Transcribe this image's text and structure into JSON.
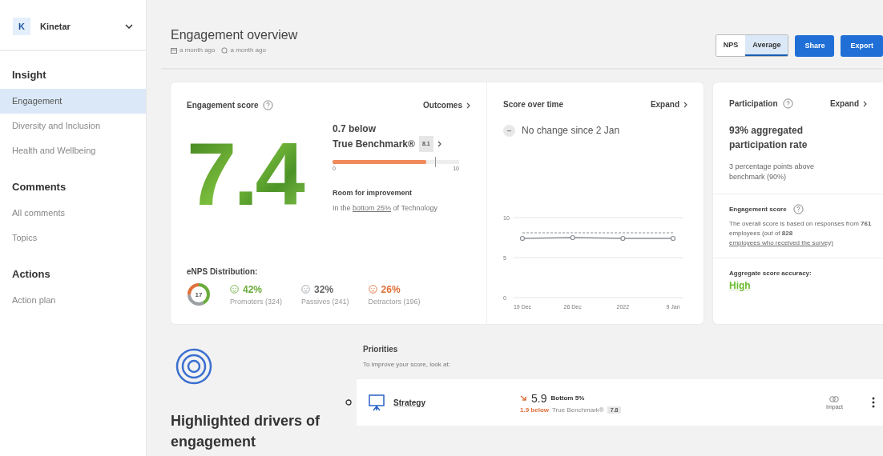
{
  "org": {
    "initial": "K",
    "name": "Kinetar"
  },
  "sidebar": {
    "sections": [
      {
        "title": "Insight",
        "items": [
          {
            "label": "Engagement",
            "selected": true
          },
          {
            "label": "Diversity and Inclusion",
            "selected": false
          },
          {
            "label": "Health and Wellbeing",
            "selected": false
          }
        ]
      },
      {
        "title": "Comments",
        "items": [
          {
            "label": "All comments",
            "selected": false
          },
          {
            "label": "Topics",
            "selected": false
          }
        ]
      },
      {
        "title": "Actions",
        "items": [
          {
            "label": "Action plan",
            "selected": false
          }
        ]
      }
    ]
  },
  "header": {
    "title": "Engagement overview",
    "created": "a month ago",
    "updated": "a month ago",
    "toggle": [
      {
        "label": "NPS",
        "selected": false
      },
      {
        "label": "Average",
        "selected": true
      }
    ],
    "buttons": [
      "Share",
      "Export"
    ]
  },
  "engagement": {
    "title": "Engagement score",
    "link": "Outcomes",
    "score": "7.4",
    "comparison": "0.7 below",
    "benchmark_label": "True Benchmark®",
    "benchmark_value": "8.1",
    "level": 0.74,
    "scale_min": "0",
    "scale_max": "10",
    "verdict": "Room for improvement",
    "rank": "In the **bottom 25%** of Technology",
    "enps": {
      "title": "eNPS Distribution:",
      "score": "17",
      "groups": [
        {
          "kind": "promoters",
          "percent": "42%",
          "label": "Promoters (324)",
          "color": "#6aab3a"
        },
        {
          "kind": "passives",
          "percent": "32%",
          "label": "Passives (241)",
          "color": "#9aa0a6"
        },
        {
          "kind": "detractors",
          "percent": "26%",
          "label": "Detractors (196)",
          "color": "#e0703a"
        }
      ]
    }
  },
  "score_over_time": {
    "title": "Score over time",
    "link": "Expand",
    "change": "No change since 2 Jan",
    "chart_data": {
      "type": "line",
      "categories": [
        "19 Dec",
        "26 Dec",
        "2022",
        "9 Jan"
      ],
      "ylim": [
        0,
        10
      ],
      "yticks": [
        0,
        5,
        10
      ],
      "series": [
        {
          "color": "#8a9096",
          "marker": "circle",
          "values": [
            7.4,
            7.5,
            7.4,
            7.4
          ]
        },
        {
          "color": "#8a9096",
          "line_style": "dashed",
          "values": [
            8.1,
            8.1,
            8.1,
            8.1
          ]
        }
      ]
    }
  },
  "participation": {
    "title": "Participation",
    "link": "Expand",
    "rate": "93% aggregated participation rate",
    "note": "3 percentage points above benchmark (90%)",
    "score_title": "Engagement score",
    "score_text": "The overall score is based on responses from **761** employees (out of **828** ",
    "score_link": "employees who received the survey)",
    "accuracy_title": "Aggregate score accuracy:",
    "accuracy": "High"
  },
  "drivers": {
    "title": "Highlighted drivers of engagement"
  },
  "priorities": {
    "title": "Priorities",
    "subtitle": "To improve your score, look at:",
    "items": [
      {
        "name": "Strategy",
        "score": "5.9",
        "rank": "Bottom 5%",
        "difference": "1.9 below",
        "benchmark_label": "True Benchmark®",
        "benchmark_value": "7.8",
        "action": "Impact"
      }
    ]
  }
}
